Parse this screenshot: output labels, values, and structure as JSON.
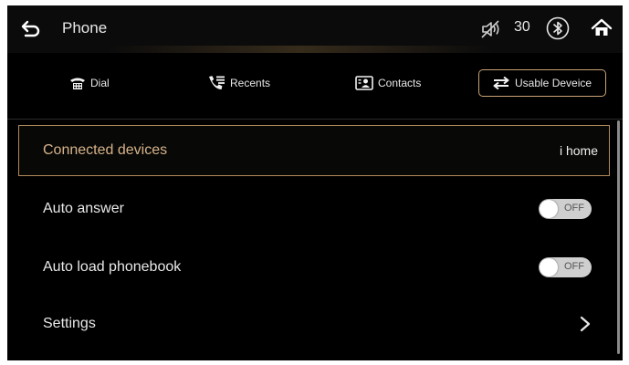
{
  "header": {
    "title": "Phone",
    "volume": "30",
    "icons": {
      "back": "back-arrow-icon",
      "mute": "volume-mute-icon",
      "bluetooth": "bluetooth-icon",
      "home": "home-icon"
    }
  },
  "tabs": [
    {
      "label": "Dial",
      "icon": "dialpad-phone-icon",
      "active": false
    },
    {
      "label": "Recents",
      "icon": "recent-calls-icon",
      "active": false
    },
    {
      "label": "Contacts",
      "icon": "contacts-icon",
      "active": false
    },
    {
      "label": "Usable Deveice",
      "icon": "swap-arrows-icon",
      "active": true
    }
  ],
  "list": [
    {
      "label": "Connected devices",
      "value": "i home",
      "selected": true
    },
    {
      "label": "Auto answer",
      "toggle": "OFF"
    },
    {
      "label": "Auto load phonebook",
      "toggle": "OFF"
    },
    {
      "label": "Settings",
      "icon": "chevron-right-icon"
    }
  ],
  "colors": {
    "accent": "#c9a476",
    "background": "#000000",
    "text": "#e8e8e8"
  }
}
